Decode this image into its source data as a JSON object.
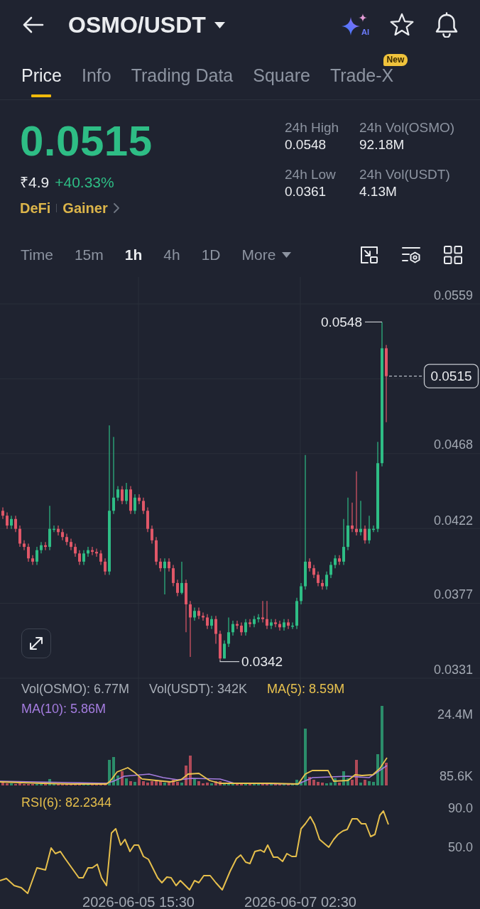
{
  "header": {
    "title": "OSMO/USDT",
    "ai_label": "AI"
  },
  "tabs": [
    {
      "label": "Price",
      "selected": true
    },
    {
      "label": "Info",
      "selected": false
    },
    {
      "label": "Trading Data",
      "selected": false
    },
    {
      "label": "Square",
      "selected": false
    },
    {
      "label": "Trade-X",
      "selected": false,
      "badge": "New"
    }
  ],
  "ticker": {
    "price": "0.0515",
    "fiat_price": "₹4.9",
    "change": "+40.33%",
    "tags": [
      "DeFi",
      "Gainer"
    ]
  },
  "stats": [
    {
      "label": "24h High",
      "value": "0.0548"
    },
    {
      "label": "24h Vol(OSMO)",
      "value": "92.18M"
    },
    {
      "label": "24h Low",
      "value": "0.0361"
    },
    {
      "label": "24h Vol(USDT)",
      "value": "4.13M"
    }
  ],
  "intervals": [
    {
      "label": "Time",
      "kind": "option",
      "selected": false
    },
    {
      "label": "15m",
      "kind": "option",
      "selected": false
    },
    {
      "label": "1h",
      "kind": "option",
      "selected": true
    },
    {
      "label": "4h",
      "kind": "option",
      "selected": false
    },
    {
      "label": "1D",
      "kind": "option",
      "selected": false
    },
    {
      "label": "More",
      "kind": "dropdown",
      "selected": false
    }
  ],
  "price_chart": {
    "chart_data": {
      "type": "candlestick",
      "grid": true,
      "ylim": [
        0.0331,
        0.0559
      ],
      "yticks": [
        {
          "value": 0.0559,
          "label": "0.0559"
        },
        {
          "value": 0.0468,
          "label": "0.0468"
        },
        {
          "value": 0.0422,
          "label": "0.0422"
        },
        {
          "value": 0.0377,
          "label": "0.0377"
        },
        {
          "value": 0.0331,
          "label": "0.0331"
        }
      ],
      "ohlc": [
        [
          0.0433,
          0.0435,
          0.0428,
          0.043
        ],
        [
          0.043,
          0.0432,
          0.0422,
          0.0424
        ],
        [
          0.0424,
          0.043,
          0.0422,
          0.0428
        ],
        [
          0.0428,
          0.043,
          0.042,
          0.0422
        ],
        [
          0.0422,
          0.0424,
          0.0411,
          0.0413
        ],
        [
          0.0413,
          0.0415,
          0.0409,
          0.0411
        ],
        [
          0.0411,
          0.0413,
          0.0402,
          0.0404
        ],
        [
          0.0404,
          0.0406,
          0.04,
          0.0402
        ],
        [
          0.0402,
          0.0411,
          0.04,
          0.0409
        ],
        [
          0.0409,
          0.0414,
          0.0407,
          0.0412
        ],
        [
          0.0412,
          0.0414,
          0.0409,
          0.0411
        ],
        [
          0.0411,
          0.0436,
          0.0409,
          0.0422
        ],
        [
          0.0422,
          0.0424,
          0.042,
          0.0422
        ],
        [
          0.0422,
          0.0424,
          0.0418,
          0.042
        ],
        [
          0.042,
          0.0422,
          0.0415,
          0.0417
        ],
        [
          0.0417,
          0.0419,
          0.0412,
          0.0414
        ],
        [
          0.0414,
          0.0416,
          0.0409,
          0.0411
        ],
        [
          0.0411,
          0.0413,
          0.0405,
          0.0407
        ],
        [
          0.0407,
          0.0409,
          0.04,
          0.0402
        ],
        [
          0.0402,
          0.0409,
          0.04,
          0.0407
        ],
        [
          0.0407,
          0.0411,
          0.0405,
          0.0409
        ],
        [
          0.0409,
          0.0411,
          0.0406,
          0.0408
        ],
        [
          0.0408,
          0.041,
          0.0405,
          0.0407
        ],
        [
          0.0407,
          0.0409,
          0.04,
          0.0402
        ],
        [
          0.0402,
          0.0404,
          0.0394,
          0.0396
        ],
        [
          0.0396,
          0.0485,
          0.0394,
          0.0433
        ],
        [
          0.0433,
          0.0478,
          0.0431,
          0.0441
        ],
        [
          0.0441,
          0.0448,
          0.0439,
          0.0446
        ],
        [
          0.0446,
          0.0448,
          0.0437,
          0.0439
        ],
        [
          0.0439,
          0.045,
          0.0437,
          0.0446
        ],
        [
          0.0446,
          0.0448,
          0.0431,
          0.0433
        ],
        [
          0.0433,
          0.0443,
          0.0431,
          0.0441
        ],
        [
          0.0441,
          0.0443,
          0.0437,
          0.0439
        ],
        [
          0.0439,
          0.0441,
          0.0431,
          0.0433
        ],
        [
          0.0433,
          0.0435,
          0.042,
          0.0422
        ],
        [
          0.0422,
          0.0424,
          0.0413,
          0.0415
        ],
        [
          0.0415,
          0.0417,
          0.04,
          0.0402
        ],
        [
          0.0402,
          0.0404,
          0.0396,
          0.0398
        ],
        [
          0.0398,
          0.0404,
          0.0382,
          0.0402
        ],
        [
          0.0402,
          0.0404,
          0.0396,
          0.0398
        ],
        [
          0.0398,
          0.04,
          0.0387,
          0.0389
        ],
        [
          0.0389,
          0.0391,
          0.0381,
          0.0383
        ],
        [
          0.0383,
          0.0402,
          0.0382,
          0.0389
        ],
        [
          0.0389,
          0.0391,
          0.0359,
          0.0376
        ],
        [
          0.0376,
          0.0378,
          0.0344,
          0.0368
        ],
        [
          0.0368,
          0.0374,
          0.0366,
          0.0372
        ],
        [
          0.0372,
          0.0374,
          0.0367,
          0.0369
        ],
        [
          0.0369,
          0.0371,
          0.0366,
          0.0368
        ],
        [
          0.0368,
          0.037,
          0.0361,
          0.0363
        ],
        [
          0.0363,
          0.0369,
          0.0361,
          0.0367
        ],
        [
          0.0367,
          0.0369,
          0.0352,
          0.0358
        ],
        [
          0.0358,
          0.036,
          0.0342,
          0.0343
        ],
        [
          0.0343,
          0.0354,
          0.0343,
          0.0352
        ],
        [
          0.0352,
          0.0368,
          0.035,
          0.0359
        ],
        [
          0.0359,
          0.0366,
          0.0357,
          0.0364
        ],
        [
          0.0364,
          0.0366,
          0.0361,
          0.0363
        ],
        [
          0.0363,
          0.0365,
          0.0357,
          0.0359
        ],
        [
          0.0359,
          0.0367,
          0.0357,
          0.0365
        ],
        [
          0.0365,
          0.0367,
          0.0362,
          0.0364
        ],
        [
          0.0364,
          0.0369,
          0.0362,
          0.0367
        ],
        [
          0.0367,
          0.037,
          0.0365,
          0.0368
        ],
        [
          0.0368,
          0.0378,
          0.0365,
          0.0367
        ],
        [
          0.0367,
          0.0378,
          0.0361,
          0.0363
        ],
        [
          0.0363,
          0.0367,
          0.0361,
          0.0365
        ],
        [
          0.0365,
          0.0367,
          0.0362,
          0.0364
        ],
        [
          0.0364,
          0.0366,
          0.036,
          0.0362
        ],
        [
          0.0362,
          0.0367,
          0.036,
          0.0365
        ],
        [
          0.0365,
          0.0367,
          0.0361,
          0.0363
        ],
        [
          0.0363,
          0.0365,
          0.0361,
          0.0363
        ],
        [
          0.0363,
          0.038,
          0.0361,
          0.0378
        ],
        [
          0.0378,
          0.0389,
          0.0376,
          0.0387
        ],
        [
          0.0387,
          0.0467,
          0.0385,
          0.0402
        ],
        [
          0.0402,
          0.0404,
          0.0396,
          0.0398
        ],
        [
          0.0398,
          0.04,
          0.0392,
          0.0394
        ],
        [
          0.0394,
          0.0396,
          0.0387,
          0.0389
        ],
        [
          0.0389,
          0.0391,
          0.0385,
          0.0387
        ],
        [
          0.0387,
          0.0396,
          0.0385,
          0.0394
        ],
        [
          0.0394,
          0.0402,
          0.0392,
          0.04
        ],
        [
          0.04,
          0.0406,
          0.0398,
          0.0404
        ],
        [
          0.0404,
          0.0406,
          0.04,
          0.0402
        ],
        [
          0.0402,
          0.0428,
          0.04,
          0.0411
        ],
        [
          0.0411,
          0.0441,
          0.0409,
          0.0424
        ],
        [
          0.0424,
          0.0438,
          0.042,
          0.0422
        ],
        [
          0.0422,
          0.0457,
          0.0418,
          0.042
        ],
        [
          0.042,
          0.0439,
          0.0418,
          0.0422
        ],
        [
          0.0422,
          0.0424,
          0.0413,
          0.0415
        ],
        [
          0.0415,
          0.043,
          0.0413,
          0.0422
        ],
        [
          0.0422,
          0.0424,
          0.042,
          0.0422
        ],
        [
          0.0422,
          0.0475,
          0.042,
          0.0462
        ],
        [
          0.0462,
          0.0548,
          0.046,
          0.0532
        ],
        [
          0.0532,
          0.0534,
          0.0487,
          0.0515
        ]
      ],
      "annotations": [
        "0.0548",
        "0.0342",
        "0.0515"
      ]
    }
  },
  "volume_chart": {
    "legend": [
      {
        "text": "Vol(OSMO): 6.77M",
        "color": "#a9afb8"
      },
      {
        "text": "Vol(USDT): 342K",
        "color": "#a9afb8"
      },
      {
        "text": "MA(5): 8.59M",
        "color": "#e9c34f"
      },
      {
        "text": "MA(10): 5.86M",
        "color": "#a57de0"
      }
    ],
    "axis_labels": [
      "24.4M",
      "85.6K"
    ]
  },
  "rsi_chart": {
    "legend": "RSI(6): 82.2344",
    "axis_labels": [
      "90.0",
      "50.0"
    ]
  },
  "time_axis": [
    "2026-06-05 15:30",
    "2026-06-07 02:30"
  ]
}
